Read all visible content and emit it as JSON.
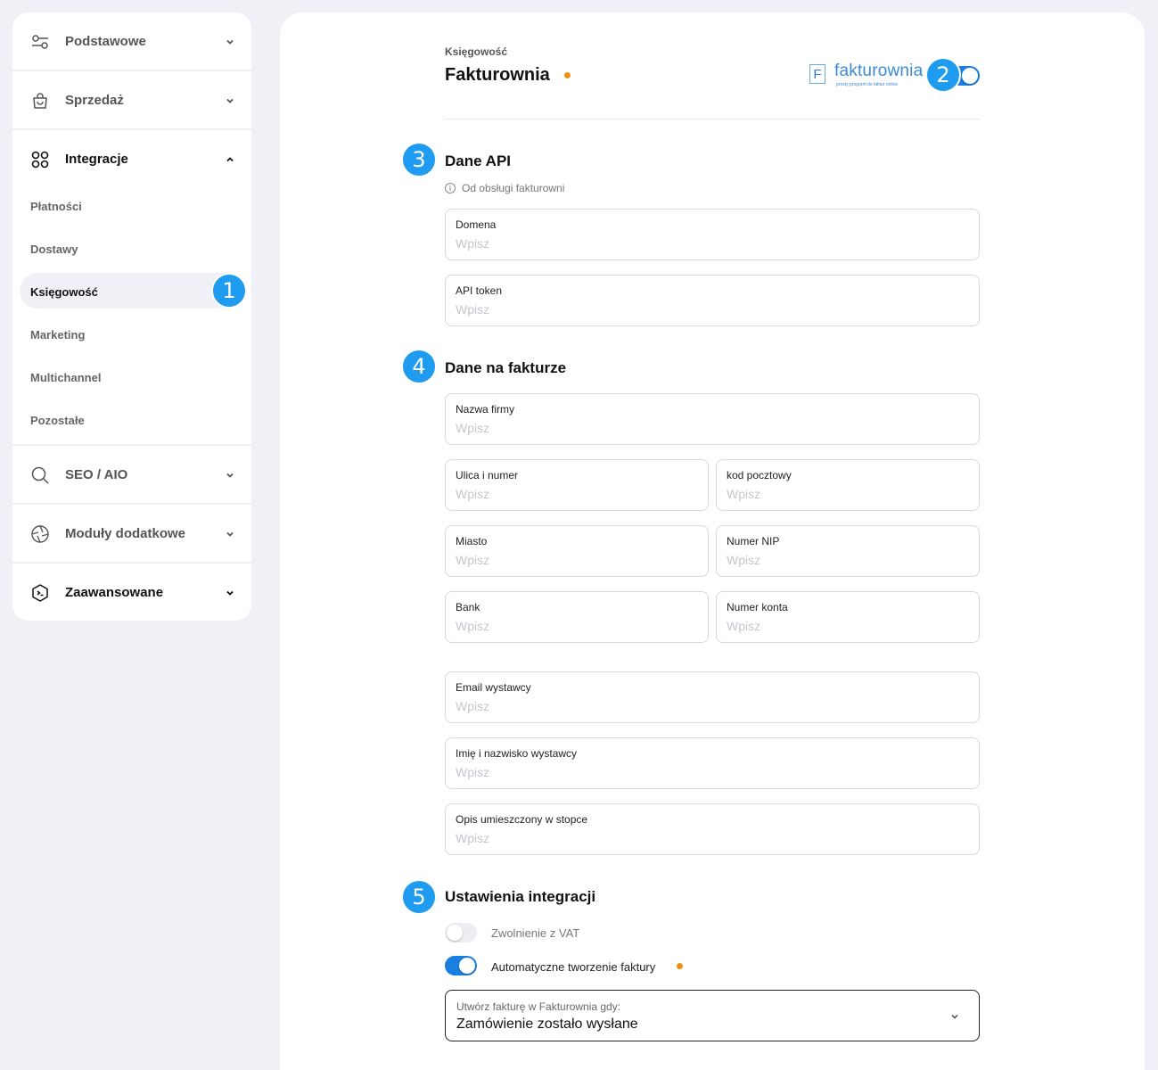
{
  "sidebar": {
    "groups": {
      "podstawowe": "Podstawowe",
      "sprzedaz": "Sprzedaż",
      "integracje": "Integracje",
      "seo": "SEO / AIO",
      "moduly": "Moduły dodatkowe",
      "zaawansowane": "Zaawansowane"
    },
    "sub_items": [
      "Płatności",
      "Dostawy",
      "Księgowość",
      "Marketing",
      "Multichannel",
      "Pozostałe"
    ],
    "active_item": "Księgowość"
  },
  "badges": [
    "1",
    "2",
    "3",
    "4",
    "5"
  ],
  "header": {
    "breadcrumb": "Księgowość",
    "title": "Fakturownia",
    "logo_text": "fakturownia",
    "logo_letter": "F",
    "logo_tagline": "prosty program do faktur online",
    "enabled": true
  },
  "sections": {
    "api": {
      "title": "Dane API",
      "hint": "Od obsługi fakturowni",
      "fields": {
        "domena": {
          "label": "Domena",
          "placeholder": "Wpisz"
        },
        "api_token": {
          "label": "API token",
          "placeholder": "Wpisz"
        }
      }
    },
    "invoice": {
      "title": "Dane na fakturze",
      "fields": {
        "nazwa_firmy": {
          "label": "Nazwa firmy",
          "placeholder": "Wpisz"
        },
        "ulica": {
          "label": "Ulica i numer",
          "placeholder": "Wpisz"
        },
        "kod": {
          "label": "kod pocztowy",
          "placeholder": "Wpisz"
        },
        "miasto": {
          "label": "Miasto",
          "placeholder": "Wpisz"
        },
        "nip": {
          "label": "Numer NIP",
          "placeholder": "Wpisz"
        },
        "bank": {
          "label": "Bank",
          "placeholder": "Wpisz"
        },
        "konto": {
          "label": "Numer konta",
          "placeholder": "Wpisz"
        },
        "email": {
          "label": "Email wystawcy",
          "placeholder": "Wpisz"
        },
        "imie": {
          "label": "Imię i nazwisko wystawcy",
          "placeholder": "Wpisz"
        },
        "opis": {
          "label": "Opis umieszczony w stopce",
          "placeholder": "Wpisz"
        }
      }
    },
    "settings": {
      "title": "Ustawienia integracji",
      "vat_label": "Zwolnienie z VAT",
      "vat_enabled": false,
      "auto_label": "Automatyczne tworzenie faktury",
      "auto_enabled": true,
      "select_label": "Utwórz fakturę w Fakturownia gdy:",
      "select_value": "Zamówienie zostało wysłane"
    }
  },
  "colors": {
    "accent": "#1a7fe0",
    "badge": "#1f9bf0",
    "warning_dot": "#f0900f"
  }
}
